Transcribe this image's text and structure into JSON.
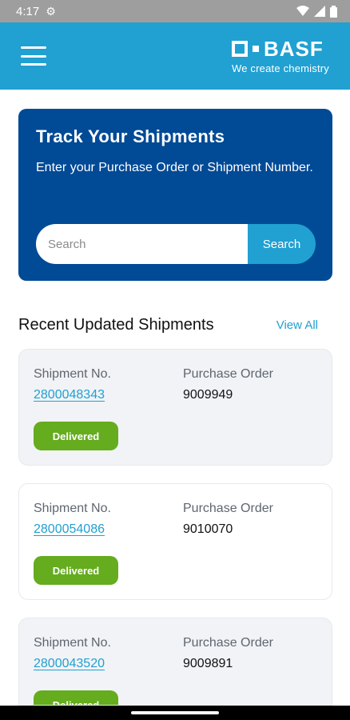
{
  "status_bar": {
    "time": "4:17"
  },
  "header": {
    "logo_text": "BASF",
    "tagline": "We create chemistry"
  },
  "track": {
    "title": "Track Your Shipments",
    "subtitle": "Enter your Purchase Order or Shipment Number.",
    "search_placeholder": "Search",
    "search_button": "Search"
  },
  "recent": {
    "title": "Recent Updated Shipments",
    "view_all": "View All",
    "shipment_label": "Shipment No.",
    "po_label": "Purchase Order",
    "items": [
      {
        "shipment_no": "2800048343",
        "purchase_order": "9009949",
        "status": "Delivered"
      },
      {
        "shipment_no": "2800054086",
        "purchase_order": "9010070",
        "status": "Delivered"
      },
      {
        "shipment_no": "2800043520",
        "purchase_order": "9009891",
        "status": "Delivered"
      }
    ]
  },
  "colors": {
    "accent": "#21a0d2",
    "brand_dark": "#004a96",
    "delivered": "#65ac1e"
  }
}
